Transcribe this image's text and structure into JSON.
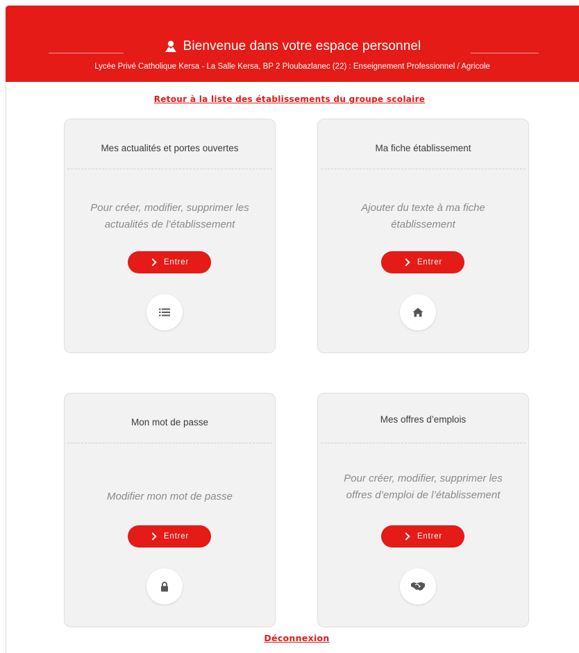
{
  "header": {
    "title": "Bienvenue dans votre espace personnel",
    "subtitle": "Lycée Privé Catholique Kersa - La Salle Kersa, BP 2 Ploubazlanec (22) : Enseignement Professionnel / Agricole",
    "icon": "user-icon",
    "background_color": "#e41b17"
  },
  "back_link": "Retour à la liste des établissements du groupe scolaire",
  "cards": [
    {
      "title": "Mes actualités et portes ouvertes",
      "description_line1": "Pour créer, modifier, supprimer les",
      "description_line2": "actualités de l’établissement",
      "button_label": "Entrer",
      "icon": "list-icon"
    },
    {
      "title": "Ma fiche établissement",
      "description_line1": "Ajouter du texte à ma fiche",
      "description_line2": "établissement",
      "button_label": "Entrer",
      "icon": "home-icon"
    },
    {
      "title": "Mon mot de passe",
      "description_line1": "Modifier mon mot de passe",
      "description_line2": "",
      "button_label": "Entrer",
      "icon": "lock-icon"
    },
    {
      "title": "Mes offres d’emplois",
      "description_line1": "Pour créer, modifier, supprimer les",
      "description_line2": "offres d’emploi de l’établissement",
      "button_label": "Entrer",
      "icon": "handshake-icon"
    }
  ],
  "logout_link": "Déconnexion",
  "colors": {
    "accent": "#e41b17",
    "card_background": "#f2f2f2",
    "description_text": "#8a8a8a"
  }
}
